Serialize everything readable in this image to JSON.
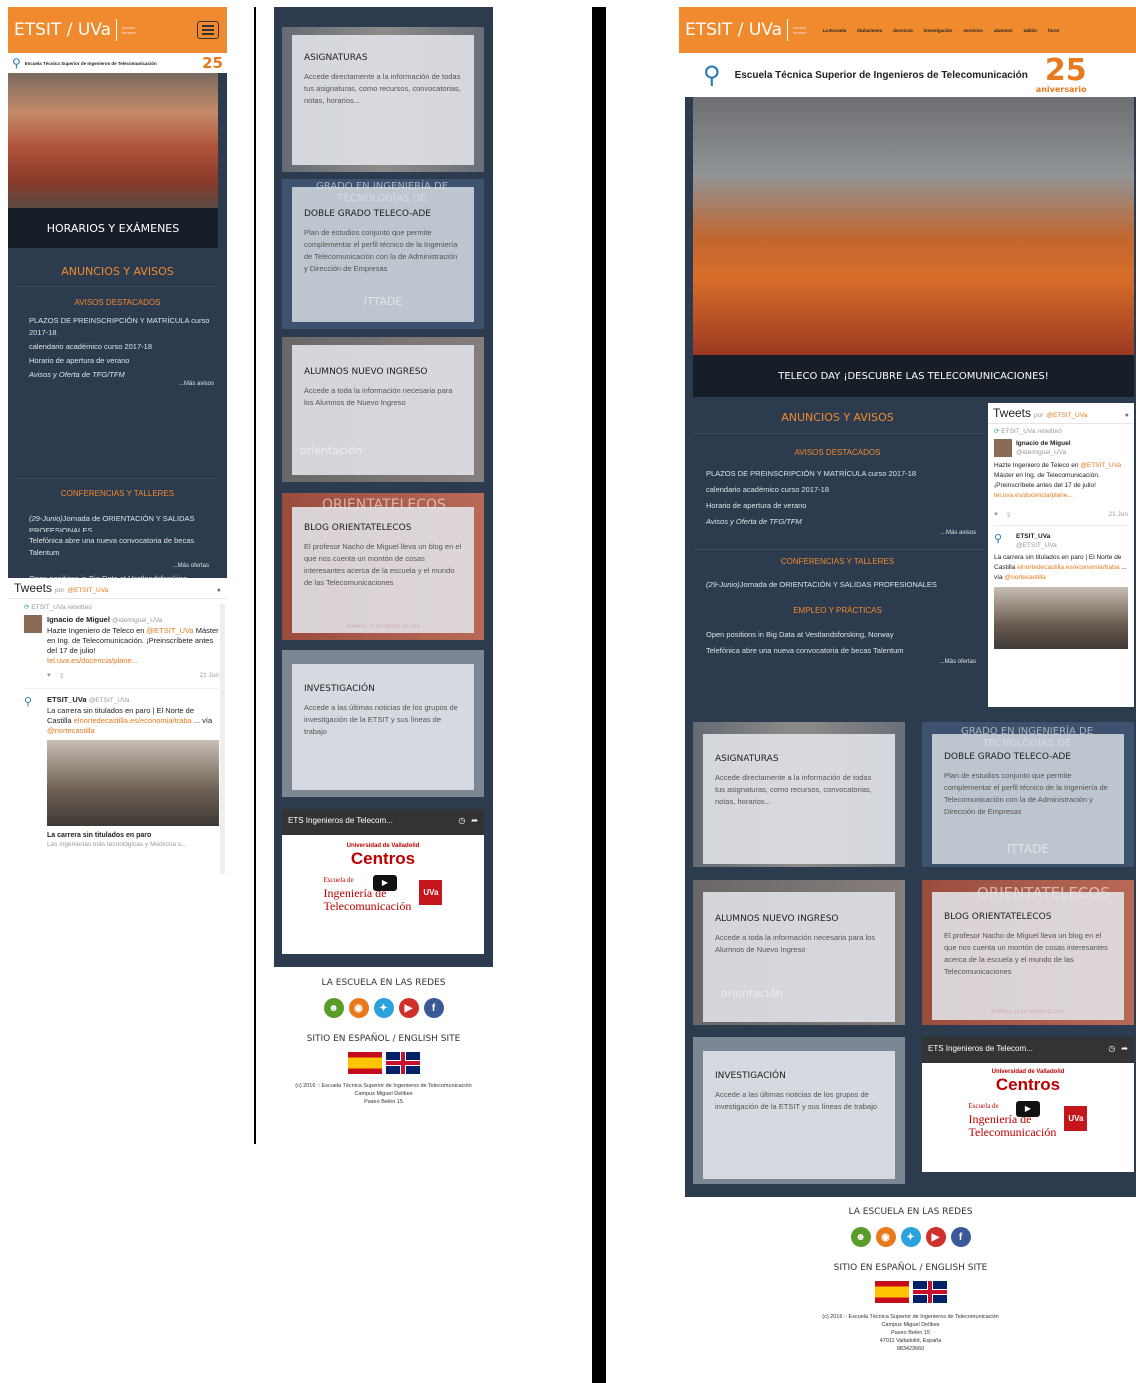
{
  "brand": "ETSIT / UVa",
  "brand_sub": [
    "Acceso",
    "Intranet"
  ],
  "school_name": "Escuela Técnica Superior de Ingenieros de Telecomunicación",
  "anniversary_num": "25",
  "anniversary_word": "aniversario",
  "nav": [
    "La Escuela",
    "titulaciones",
    "docencia",
    "investigación",
    "servicios",
    "alumnos",
    "tablón",
    "foros"
  ],
  "slides": {
    "mobile": "HORARIOS Y EXÁMENES",
    "desktop": "TELECO DAY ¡DESCUBRE LAS TELECOMUNICACIONES!"
  },
  "news": {
    "title": "ANUNCIOS Y AVISOS",
    "highlight_title": "AVISOS DESTACADOS",
    "highlight_items": [
      "PLAZOS DE PREINSCRIPCIÓN Y MATRÍCULA curso 2017-18",
      "calendario académico curso 2017-18",
      "Horario de apertura de verano",
      "Avisos y Oferta de TFG/TFM"
    ],
    "more_avisos": "...Más avisos",
    "conf_title": "CONFERENCIAS Y TALLERES",
    "conf_prefix": "(29-Junio)",
    "conf_text": "Jornada de ORIENTACIÓN Y SALIDAS PROFESIONALES",
    "jobs_title": "EMPLEO Y PRÁCTICAS",
    "jobs_items": [
      "Open positions in Big Data at Vestlandsforsking, Norway",
      "Telefónica abre una nueva convocatoria de becas Talentum"
    ],
    "more_ofertas": "...Más ofertas"
  },
  "tweets": {
    "title": "Tweets",
    "by": "por",
    "handle": "@ETSIT_UVa",
    "retweeted": "ETSIT_UVa retwitteó",
    "t1_name": "Ignacio de Miguel",
    "t1_handle": "@idemiguel_UVa",
    "t1_text_a": "Hazte Ingeniero de Teleco en",
    "t1_text_b": "Máster en Ing. de Telecomunicación. ¡Preinscríbete antes del 17 de julio!",
    "t1_link": "tel.uva.es/docencia/plane...",
    "t1_date": "21 Jun",
    "t2_name": "ETSIT_UVa",
    "t2_handle": "@ETSIT_UVa",
    "t2_text": "La carrera sin titulados en paro | El Norte de Castilla",
    "t2_link": "elnortedecastilla.es/economia/traba",
    "t2_via": "... vía",
    "t2_via_handle": "@nortecastilla",
    "card_title": "La carrera sin titulados en paro",
    "card_desc": "Las ingenierías más tecnológicas y Medicina s..."
  },
  "cards": [
    {
      "title": "ASIGNATURAS",
      "desc": "Accede directamente a la información de todas tus asignaturas, como recursos, convocatorias, notas, horarios..."
    },
    {
      "title": "DOBLE GRADO TELECO-ADE",
      "desc": "Plan de estudios conjunto que permite complementar el perfil técnico de la Ingeniería de Telecomunicación con la de Administración y Dirección de Empresas",
      "ghost_top": "GRADO EN INGENIERÍA DE TECNOLOGÍAS DE",
      "ghost_bottom": "ITTADE"
    },
    {
      "title": "ALUMNOS NUEVO INGRESO",
      "desc": "Accede a toda la información necesaria para los Alumnos de Nuevo Ingreso",
      "ghost_bottom": "orientación"
    },
    {
      "title": "BLOG ORIENTATELECOS",
      "desc": "El profesor Nacho de Miguel lleva un blog en el que nos cuenta un montón de cosas interesantes acerca de la escuela y el mundo de las Telecomunicaciones",
      "ghost_top": "ORIENTATELECOS",
      "ghost_date": "DOMINGO, 11 DE FEBRERO DE 2018"
    },
    {
      "title": "INVESTIGACIÓN",
      "desc": "Accede a las últimas noticias de los grupos de investigación de la ETSIT y sus líneas de trabajo"
    }
  ],
  "video": {
    "title": "ETS Ingenieros de Telecom...",
    "uni": "Universidad de Valladolid",
    "centros": "Centros",
    "escuela": "Escuela de",
    "ingenieria": "Ingeniería de",
    "telecom": "Telecomunicación",
    "uva": "UVa"
  },
  "footer": {
    "social_title": "LA ESCUELA EN LAS REDES",
    "site_title": "SITIO EN ESPAÑOL / ENGLISH SITE",
    "copyright": "(c) 2016 :: Escuela Técnica Superior de Ingenieros de Telecomunicación",
    "addr1": "Campus Miguel Delibes",
    "addr2": "Paseo Belén 15",
    "addr3": "47011 Valladolid, España",
    "phone": "983423660"
  },
  "colors": {
    "orange": "#ef8a2e",
    "navy": "#2d3b4e"
  }
}
